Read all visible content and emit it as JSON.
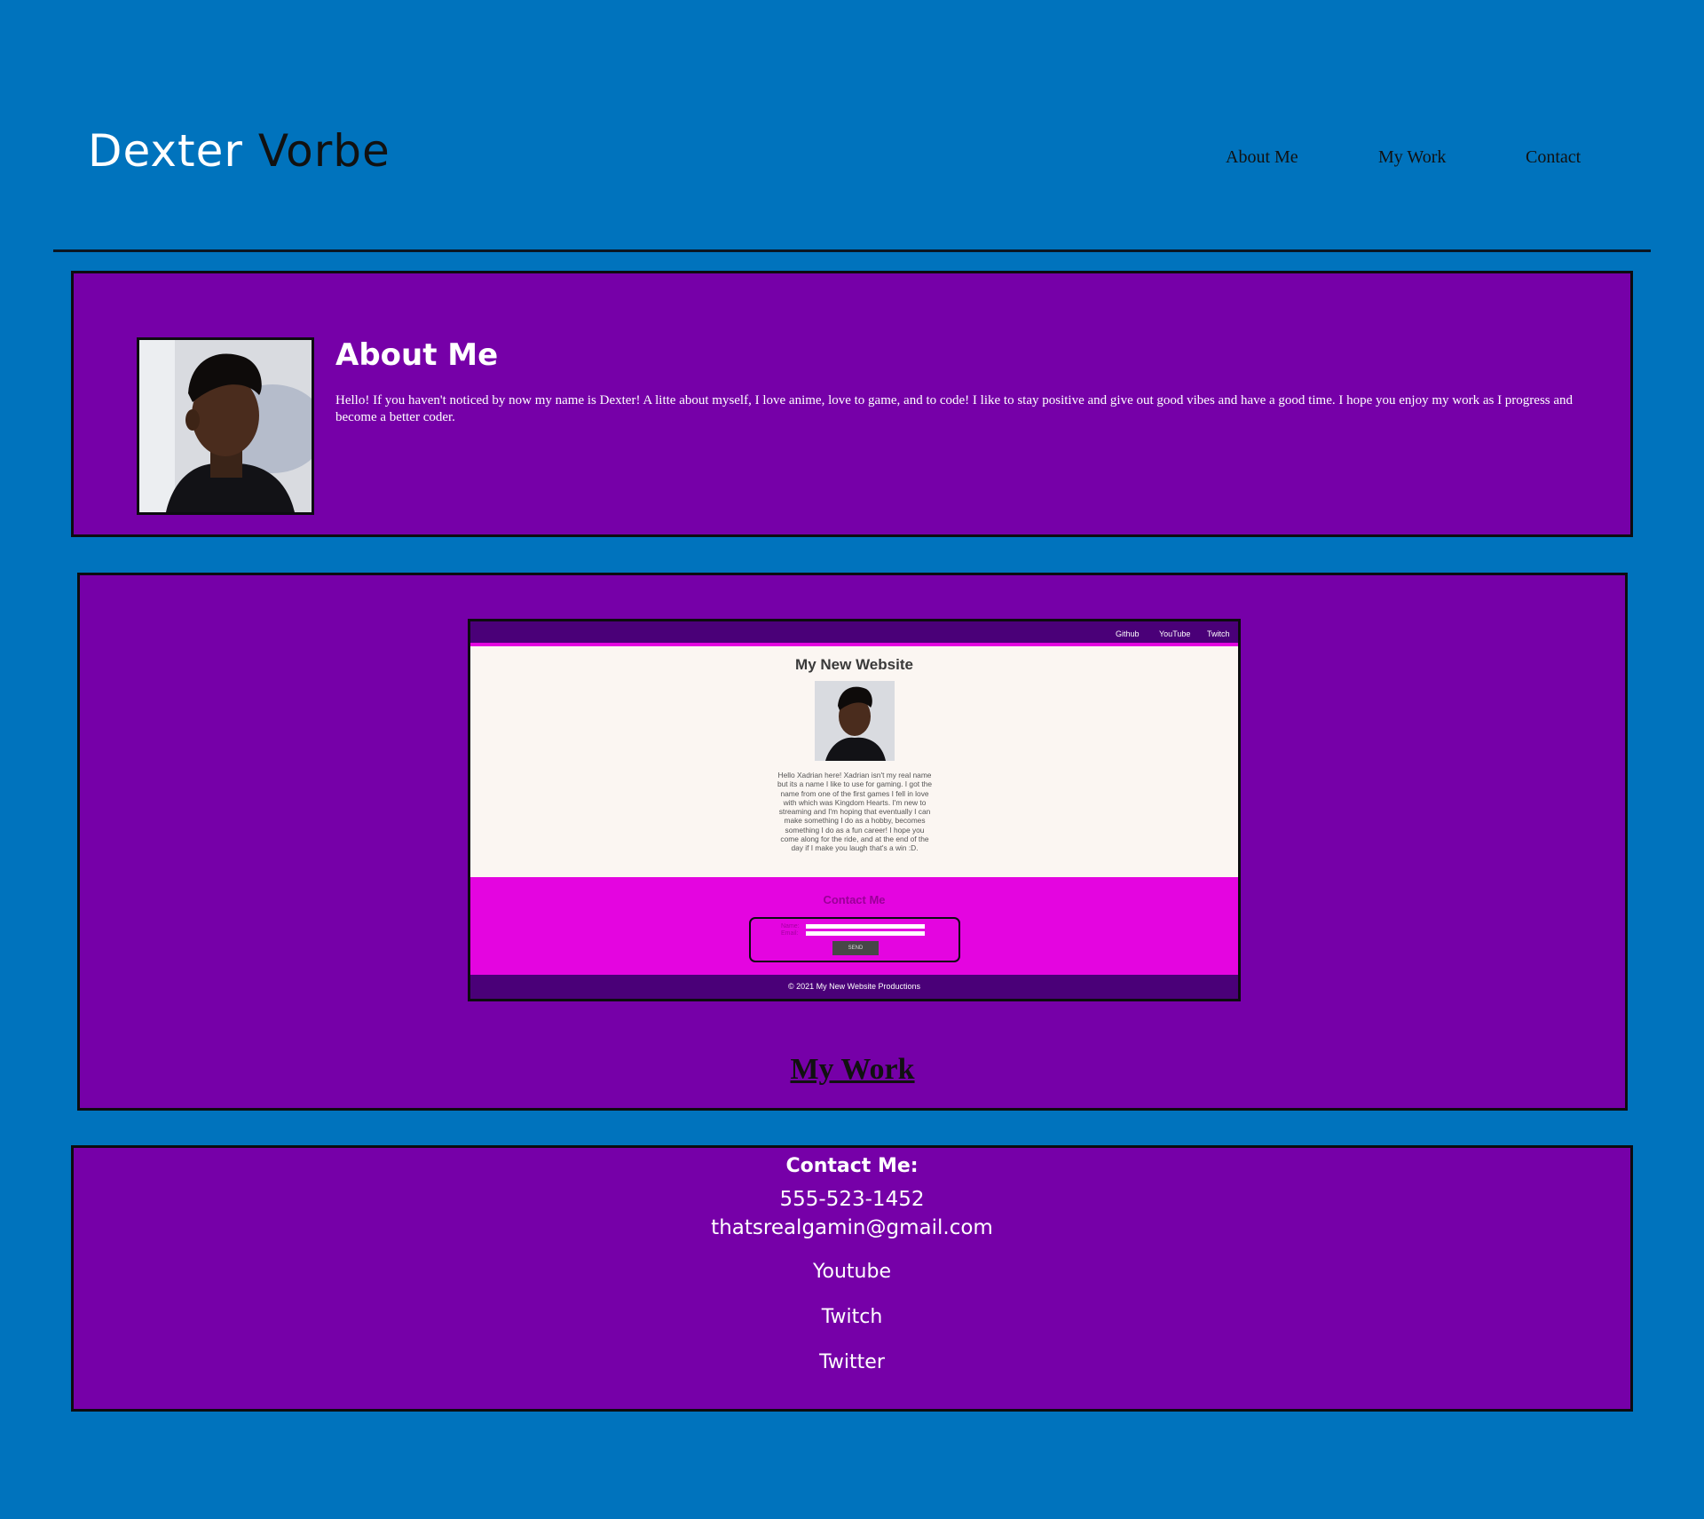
{
  "header": {
    "title_first": "Dexter",
    "title_last": "Vorbe",
    "nav": [
      "About Me",
      "My Work",
      "Contact"
    ]
  },
  "about": {
    "title": "About Me",
    "text": "Hello! If you haven't noticed by now my name is Dexter! A litte about myself, I love anime, love to game, and to code! I like to stay positive and give out good vibes and have a good time. I hope you enjoy my work as I progress and become a better coder."
  },
  "work": {
    "preview": {
      "nav": [
        "Github",
        "YouTube",
        "Twitch"
      ],
      "title": "My New Website",
      "text": "Hello Xadrian here! Xadrian isn't my real name but its a name I like to use for gaming. I got the name from one of the first games I fell in love with which was Kingdom Hearts. I'm new to streaming and I'm hoping that eventually I can make something I do as a hobby, becomes something I do as a fun career! I hope you come along for the ride, and at the end of the day if I make you laugh that's a win :D.",
      "contact_title": "Contact Me",
      "name_label": "Name:",
      "email_label": "Email:",
      "send_label": "SEND",
      "footer": "© 2021 My New Website Productions"
    },
    "link_label": "My Work"
  },
  "contact": {
    "title": "Contact Me:",
    "phone": "555-523-1452",
    "email": "thatsrealgamin@gmail.com",
    "links": [
      "Youtube",
      "Twitch",
      "Twitter"
    ]
  },
  "colors": {
    "background": "#0073bd",
    "panel": "#7600a8",
    "preview_nav": "#4a0078",
    "preview_accent": "#e405e0"
  },
  "icons": [
    "profile-photo",
    "preview-profile-photo"
  ]
}
